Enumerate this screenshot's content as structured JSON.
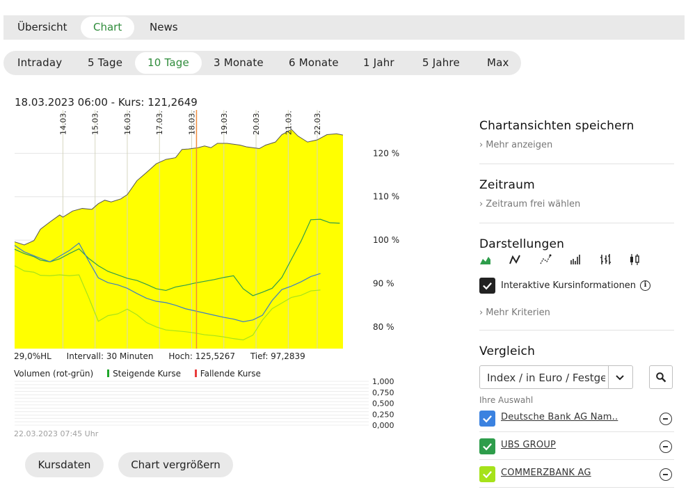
{
  "tabs": [
    {
      "label": "Übersicht"
    },
    {
      "label": "Chart",
      "active": true
    },
    {
      "label": "News"
    }
  ],
  "ranges": [
    {
      "label": "Intraday"
    },
    {
      "label": "5 Tage"
    },
    {
      "label": "10 Tage",
      "active": true
    },
    {
      "label": "3 Monate"
    },
    {
      "label": "6 Monate"
    },
    {
      "label": "1 Jahr"
    },
    {
      "label": "5 Jahre"
    },
    {
      "label": "Max"
    }
  ],
  "chart": {
    "header": "18.03.2023 06:00  -  Kurs: 121,2649",
    "info_hl": "29,0%HL",
    "info_intervall": "Intervall: 30 Minuten",
    "info_hoch": "Hoch: 125,5267",
    "info_tief": "Tief: 97,2839",
    "volume_label": "Volumen (rot-grün)",
    "legend_up": "Steigende Kurse",
    "legend_down": "Fallende Kurse",
    "timestamp": "22.03.2023 07:45 Uhr"
  },
  "chart_data": [
    {
      "type": "area",
      "x": [
        "14.03.",
        "15.03.",
        "16.03.",
        "17.03.",
        "18.03.",
        "19.03.",
        "20.03.",
        "21.03.",
        "22.03."
      ],
      "ytick_labels": [
        "80 %",
        "90 %",
        "100 %",
        "110 %",
        "120 %"
      ],
      "ylim": [
        75,
        130
      ],
      "grid": true,
      "cursor_x": "18.03.",
      "area_color": "#ffff00",
      "series": [
        {
          "color": "#555555",
          "points": [
            [
              0,
              99.6
            ],
            [
              0.3,
              98.9
            ],
            [
              0.6,
              99.9
            ],
            [
              0.8,
              102.5
            ],
            [
              1.1,
              104.2
            ],
            [
              1.4,
              105.8
            ],
            [
              1.5,
              105.3
            ],
            [
              1.8,
              106.7
            ],
            [
              2.1,
              107.3
            ],
            [
              2.4,
              107.1
            ],
            [
              2.6,
              108.4
            ],
            [
              2.8,
              109.2
            ],
            [
              3.0,
              108.8
            ],
            [
              3.3,
              109.5
            ],
            [
              3.5,
              110.5
            ],
            [
              3.8,
              113.7
            ],
            [
              4.1,
              115.6
            ],
            [
              4.4,
              117.6
            ],
            [
              4.7,
              118.6
            ],
            [
              5.0,
              119.0
            ],
            [
              5.2,
              120.9
            ],
            [
              5.4,
              121.0
            ],
            [
              5.7,
              121.3
            ],
            [
              5.9,
              121.7
            ],
            [
              6.1,
              121.3
            ],
            [
              6.3,
              122.3
            ],
            [
              6.6,
              122.3
            ],
            [
              7.0,
              121.9
            ],
            [
              7.2,
              121.5
            ],
            [
              7.6,
              121.1
            ],
            [
              7.8,
              121.9
            ],
            [
              8.1,
              122.6
            ],
            [
              8.3,
              124.3
            ],
            [
              8.6,
              125.5
            ],
            [
              8.8,
              124.0
            ],
            [
              9.1,
              122.6
            ],
            [
              9.4,
              123.1
            ],
            [
              9.7,
              124.3
            ],
            [
              10.0,
              124.5
            ],
            [
              10.2,
              124.2
            ]
          ]
        },
        {
          "color": "#2e9d4b",
          "points": [
            [
              0,
              97.9
            ],
            [
              0.3,
              96.9
            ],
            [
              0.6,
              96.2
            ],
            [
              0.8,
              95.4
            ],
            [
              1.1,
              95.0
            ],
            [
              1.4,
              95.7
            ],
            [
              1.7,
              96.9
            ],
            [
              2.0,
              98.0
            ],
            [
              2.3,
              95.8
            ],
            [
              2.6,
              94.1
            ],
            [
              2.9,
              92.8
            ],
            [
              3.2,
              92.0
            ],
            [
              3.5,
              91.2
            ],
            [
              3.8,
              90.7
            ],
            [
              4.1,
              89.8
            ],
            [
              4.4,
              88.8
            ],
            [
              4.7,
              88.4
            ],
            [
              5.0,
              89.2
            ],
            [
              5.3,
              89.6
            ],
            [
              5.6,
              90.1
            ],
            [
              5.9,
              90.5
            ],
            [
              6.2,
              90.9
            ],
            [
              6.5,
              91.4
            ],
            [
              6.8,
              91.8
            ],
            [
              7.1,
              88.8
            ],
            [
              7.4,
              87.2
            ],
            [
              7.7,
              88.0
            ],
            [
              8.0,
              88.9
            ],
            [
              8.3,
              91.4
            ],
            [
              8.6,
              95.6
            ],
            [
              8.9,
              99.8
            ],
            [
              9.2,
              104.7
            ],
            [
              9.5,
              104.8
            ],
            [
              9.8,
              104.0
            ],
            [
              10.1,
              103.9
            ]
          ]
        },
        {
          "color": "#3c7ec4",
          "points": [
            [
              0,
              98.8
            ],
            [
              0.3,
              97.3
            ],
            [
              0.6,
              96.4
            ],
            [
              0.8,
              95.8
            ],
            [
              1.1,
              95.0
            ],
            [
              1.4,
              96.3
            ],
            [
              1.7,
              97.6
            ],
            [
              2.0,
              99.3
            ],
            [
              2.3,
              95.2
            ],
            [
              2.6,
              91.3
            ],
            [
              2.9,
              90.2
            ],
            [
              3.2,
              89.7
            ],
            [
              3.5,
              88.9
            ],
            [
              3.8,
              87.7
            ],
            [
              4.1,
              86.6
            ],
            [
              4.4,
              85.9
            ],
            [
              4.7,
              85.6
            ],
            [
              5.0,
              85.0
            ],
            [
              5.3,
              84.2
            ],
            [
              5.6,
              83.7
            ],
            [
              5.9,
              83.2
            ],
            [
              6.2,
              82.7
            ],
            [
              6.5,
              82.2
            ],
            [
              6.8,
              81.8
            ],
            [
              7.1,
              81.2
            ],
            [
              7.4,
              81.6
            ],
            [
              7.7,
              82.7
            ],
            [
              8.0,
              86.1
            ],
            [
              8.3,
              88.6
            ],
            [
              8.6,
              89.4
            ],
            [
              8.9,
              90.4
            ],
            [
              9.2,
              91.6
            ],
            [
              9.5,
              92.3
            ]
          ]
        },
        {
          "color": "#a6e21a",
          "points": [
            [
              0,
              94.1
            ],
            [
              0.3,
              92.9
            ],
            [
              0.6,
              92.6
            ],
            [
              0.8,
              91.9
            ],
            [
              1.1,
              91.8
            ],
            [
              1.4,
              92.0
            ],
            [
              1.7,
              91.8
            ],
            [
              2.0,
              92.0
            ],
            [
              2.3,
              86.8
            ],
            [
              2.6,
              81.3
            ],
            [
              2.9,
              82.6
            ],
            [
              3.2,
              83.0
            ],
            [
              3.5,
              84.1
            ],
            [
              3.8,
              82.8
            ],
            [
              4.1,
              81.0
            ],
            [
              4.4,
              80.0
            ],
            [
              4.7,
              79.3
            ],
            [
              5.0,
              79.1
            ],
            [
              5.3,
              78.9
            ],
            [
              5.6,
              78.6
            ],
            [
              5.9,
              78.2
            ],
            [
              6.2,
              78.0
            ],
            [
              6.5,
              77.7
            ],
            [
              6.8,
              77.3
            ],
            [
              7.1,
              77.0
            ],
            [
              7.4,
              78.1
            ],
            [
              7.7,
              81.6
            ],
            [
              8.0,
              84.2
            ],
            [
              8.3,
              85.5
            ],
            [
              8.6,
              86.8
            ],
            [
              8.9,
              87.3
            ],
            [
              9.2,
              88.3
            ],
            [
              9.5,
              88.5
            ]
          ]
        }
      ]
    },
    {
      "type": "bar",
      "title": "Volumen (rot-grün)",
      "ytick_labels": [
        "1,000",
        "0,750",
        "0,500",
        "0,250",
        "0,000"
      ],
      "ylim": [
        0,
        1
      ],
      "grid": true,
      "values": []
    }
  ],
  "right": {
    "save_title": "Chartansichten speichern",
    "save_link": "Mehr anzeigen",
    "zeitraum_title": "Zeitraum",
    "zeitraum_link": "Zeitraum frei wählen",
    "darstellungen_title": "Darstellungen",
    "view_icons": [
      "area-chart-icon",
      "line-chart-icon",
      "dot-line-chart-icon",
      "volume-bars-icon",
      "ohlc-icon",
      "candlestick-icon"
    ],
    "interaktiv_label": "Interaktive Kursinformationen",
    "mehr_kriterien": "Mehr Kriterien",
    "vergleich_title": "Vergleich",
    "select_value": "Index / in Euro / Festgeld",
    "ihre_auswahl": "Ihre Auswahl",
    "comparisons": [
      {
        "name": "Deutsche Bank AG Nam..",
        "color": "#3b82e0"
      },
      {
        "name": "UBS GROUP",
        "color": "#2e9d4b"
      },
      {
        "name": "COMMERZBANK AG",
        "color": "#a6e21a"
      }
    ]
  },
  "buttons": {
    "kursdaten": "Kursdaten",
    "vergroessern": "Chart vergrößern"
  }
}
